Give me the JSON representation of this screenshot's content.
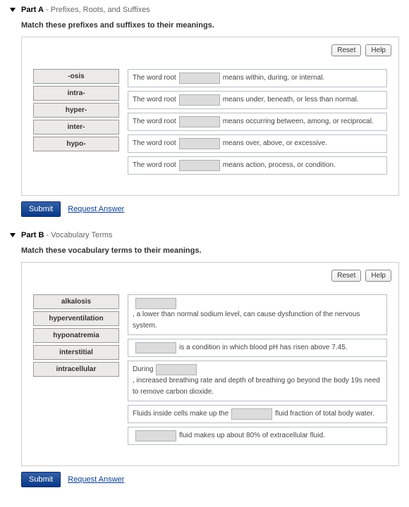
{
  "buttons": {
    "reset": "Reset",
    "help": "Help",
    "submit": "Submit",
    "request_answer": "Request Answer"
  },
  "partA": {
    "label_bold": "Part A",
    "label_sub": " - Prefixes, Roots, and Suffixes",
    "instructions": "Match these prefixes and suffixes to their meanings.",
    "terms": [
      "-osis",
      "intra-",
      "hyper-",
      "inter-",
      "hypo-"
    ],
    "targets": [
      {
        "pre": "The word root ",
        "post": " means within, during, or internal."
      },
      {
        "pre": "The word root ",
        "post": " means under, beneath, or less than normal."
      },
      {
        "pre": "The word root ",
        "post": " means occurring between, among, or reciprocal."
      },
      {
        "pre": "The word root ",
        "post": " means over, above, or excessive."
      },
      {
        "pre": "The word root ",
        "post": " means action, process, or condition."
      }
    ]
  },
  "partB": {
    "label_bold": "Part B",
    "label_sub": " - Vocabulary Terms",
    "instructions": "Match these vocabulary terms to their meanings.",
    "terms": [
      "alkalosis",
      "hyperventilation",
      "hyponatremia",
      "interstitial",
      "intracellular"
    ],
    "targets": [
      {
        "pre": "",
        "post": " , a lower than normal sodium level, can cause dysfunction of the nervous system."
      },
      {
        "pre": "",
        "post": " is a condition in which blood pH has risen above 7.45."
      },
      {
        "pre": "During ",
        "post": " , increased breathing rate and depth of breathing go beyond the body 19s need to remove carbon dioxide."
      },
      {
        "pre": "Fluids inside cells make up the ",
        "post": " fluid fraction of total body water."
      },
      {
        "pre": "",
        "post": " fluid makes up about 80% of extracellular fluid."
      }
    ]
  }
}
